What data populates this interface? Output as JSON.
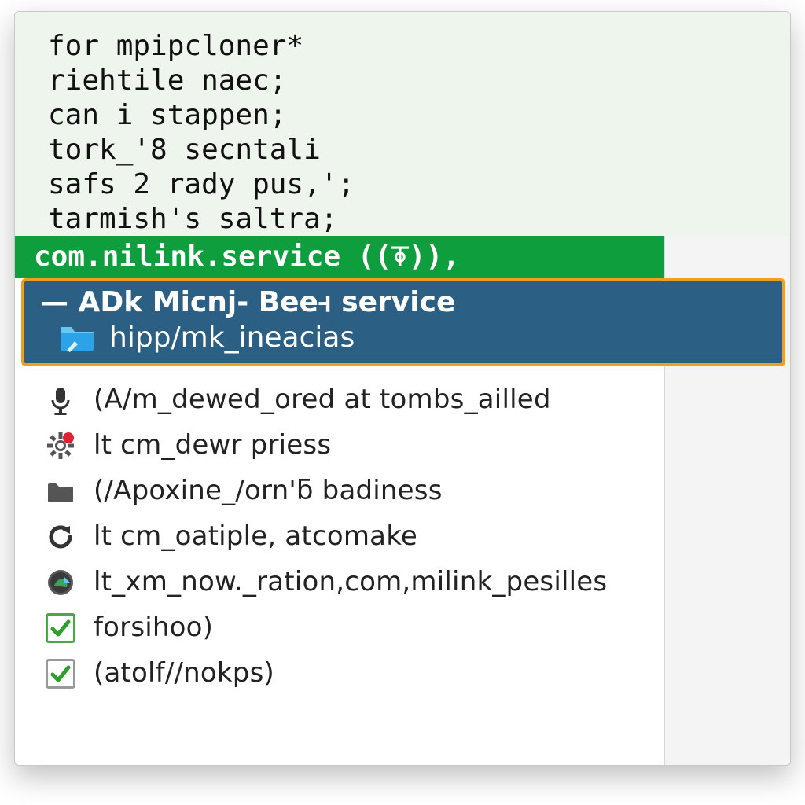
{
  "code": {
    "lines": [
      "for mpipcloner*",
      "riehtile naec;",
      "can i stappen;",
      "tork_'8 secntali",
      "safs 2 rady pus,';",
      "tarmish's saltra;"
    ]
  },
  "service_header": {
    "name": "com.nilink.service",
    "suffix_open": " ((",
    "glyph": "⍕",
    "suffix_close": ")),"
  },
  "selected": {
    "line1": "— ADk  Micnj- Beeꟶ  service",
    "line2": "hipp/mk_ineacias",
    "icon": "folder-share-icon"
  },
  "list": [
    {
      "icon": "mic-icon",
      "label": "(A/m_dewed_ored at tombs_ailled"
    },
    {
      "icon": "gear-badge-icon",
      "label": "lt cm_dewr priess"
    },
    {
      "icon": "folder-icon",
      "label": "(/Apoxine_/orn'ƃ badiness"
    },
    {
      "icon": "refresh-icon",
      "label": "lt cm_oatiple, atcomake"
    },
    {
      "icon": "globe-app-icon",
      "label": "lt_xm_now._ration,com,milink_pesilles"
    },
    {
      "icon": "check-green-icon",
      "label": "forsihoo)"
    },
    {
      "icon": "check-gray-icon",
      "label": "(atolf//nokps)"
    }
  ]
}
